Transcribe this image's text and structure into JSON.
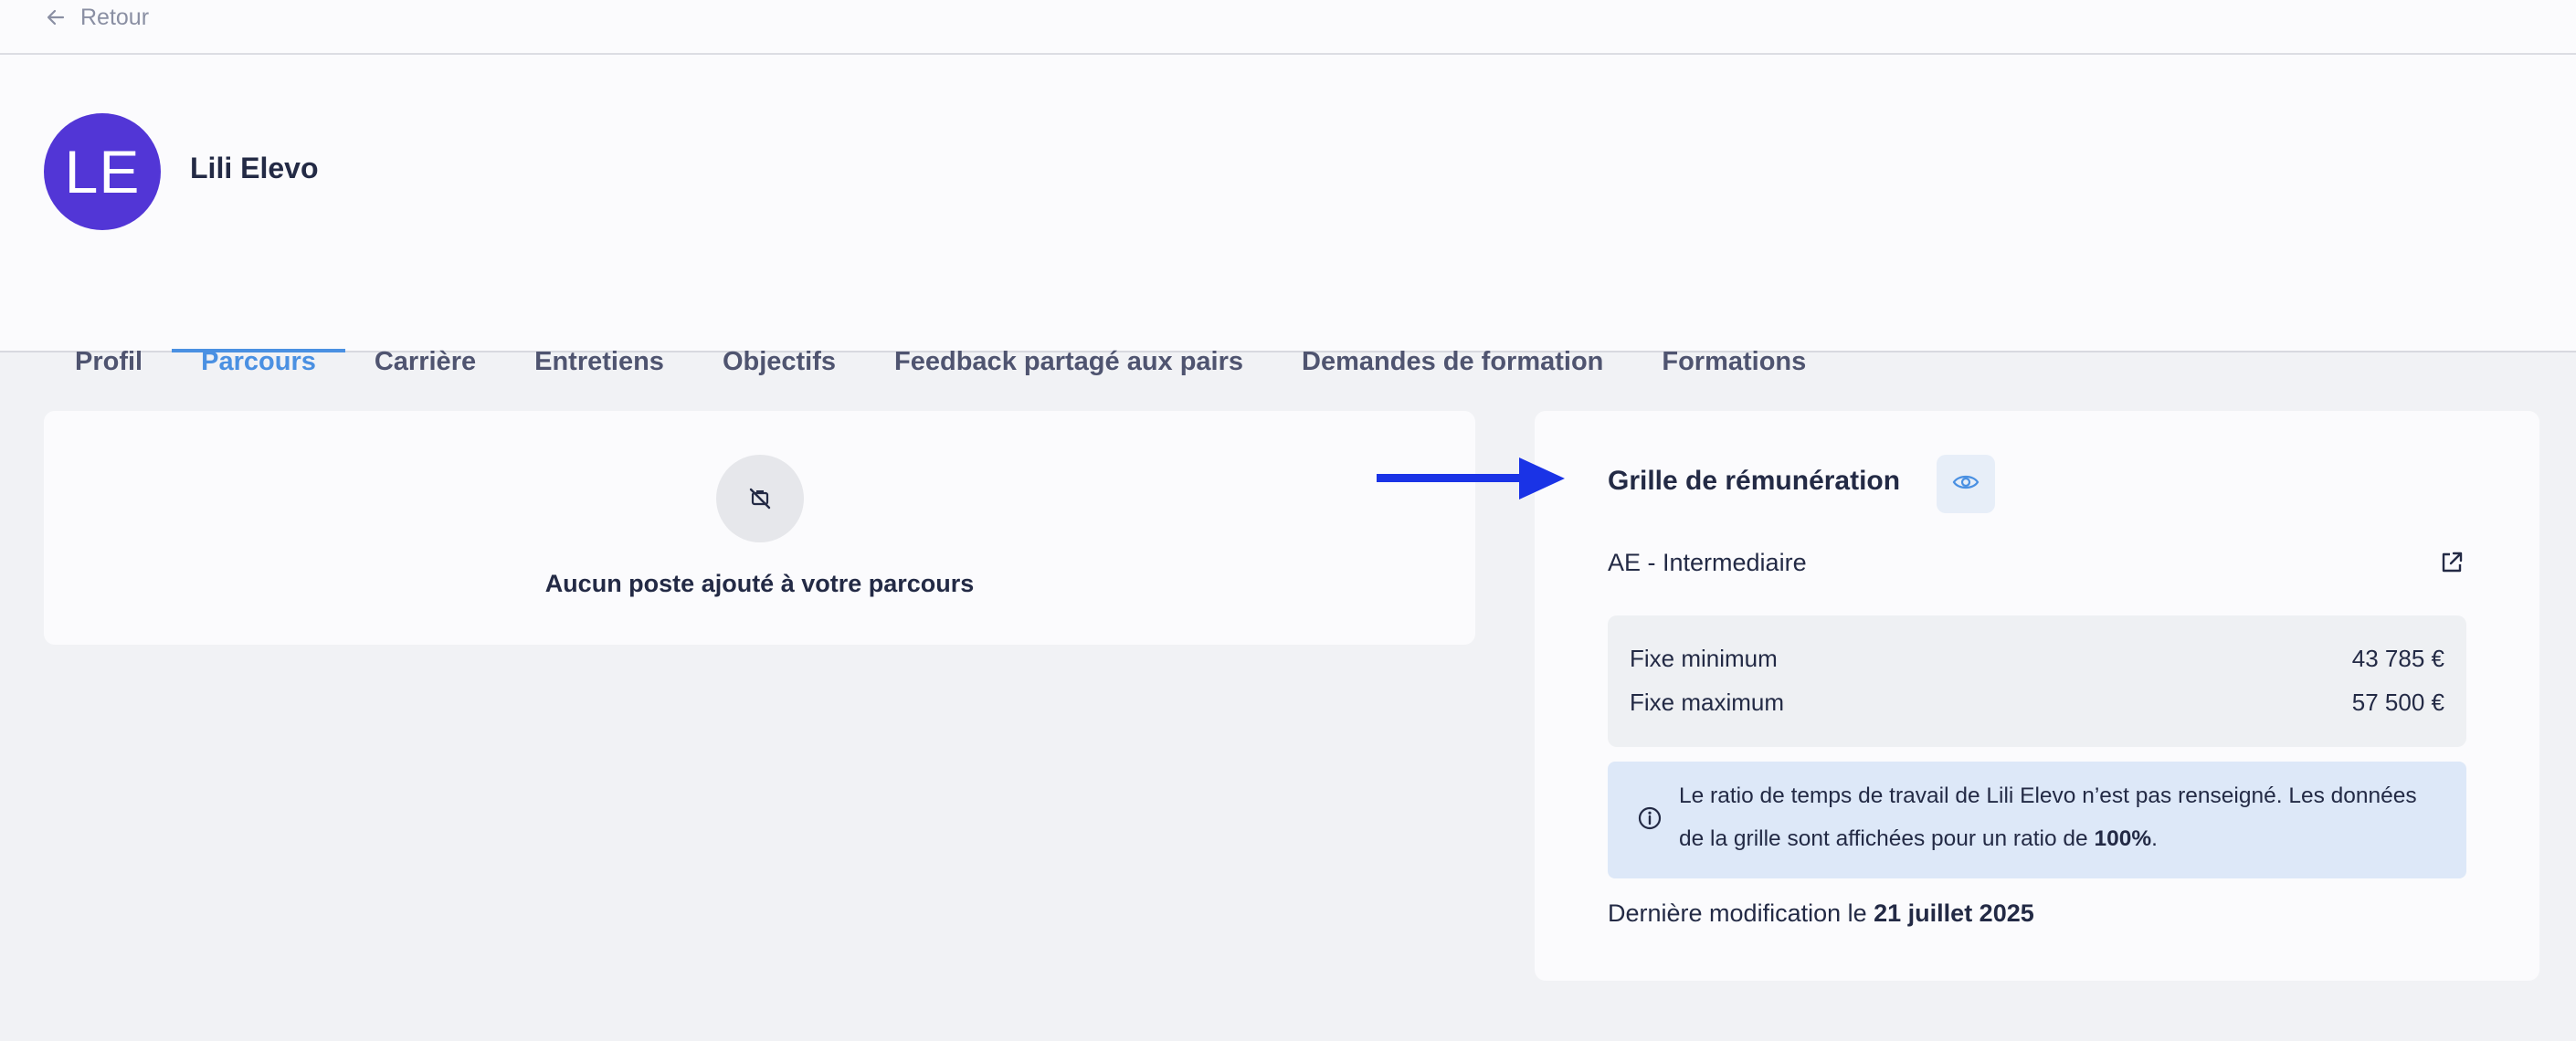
{
  "nav": {
    "back_label": "Retour"
  },
  "profile": {
    "initials": "LE",
    "name": "Lili Elevo",
    "avatar_color": "#5236d6"
  },
  "tabs": [
    {
      "label": "Profil",
      "active": false
    },
    {
      "label": "Parcours",
      "active": true
    },
    {
      "label": "Carrière",
      "active": false
    },
    {
      "label": "Entretiens",
      "active": false
    },
    {
      "label": "Objectifs",
      "active": false
    },
    {
      "label": "Feedback partagé aux pairs",
      "active": false
    },
    {
      "label": "Demandes de formation",
      "active": false
    },
    {
      "label": "Formations",
      "active": false
    }
  ],
  "parcours": {
    "empty_message": "Aucun poste ajouté à votre parcours"
  },
  "salary_grid": {
    "title": "Grille de rémunération",
    "level": "AE - Intermediaire",
    "ranges": [
      {
        "label": "Fixe minimum",
        "value": "43 785 €"
      },
      {
        "label": "Fixe maximum",
        "value": "57 500 €"
      }
    ],
    "info_part1": "Le ratio de temps de travail de Lili Elevo n’est pas renseigné. Les données de la grille sont affichées pour un ratio de ",
    "info_ratio": "100%",
    "info_part2": ".",
    "modified_prefix": "Dernière modification le ",
    "modified_date": "21 juillet 2025"
  },
  "colors": {
    "accent": "#4a90e2",
    "arrow": "#1a33e6",
    "info_bg": "#dde8f8"
  },
  "icons": [
    "arrow-left-icon",
    "no-job-icon",
    "eye-icon",
    "external-link-icon",
    "info-icon",
    "annotation-arrow-icon"
  ]
}
